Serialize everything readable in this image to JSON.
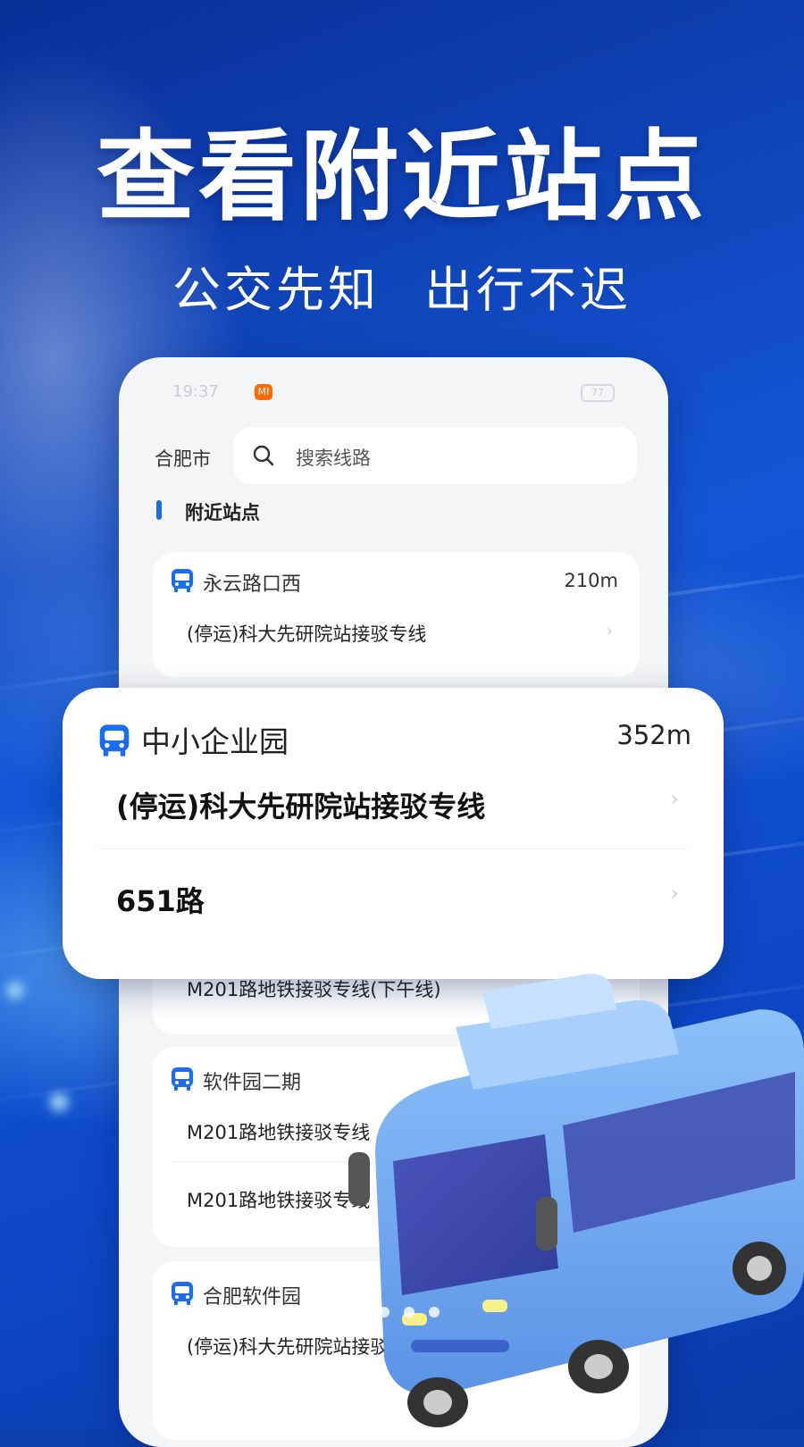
{
  "headline": "查看附近站点",
  "subline": {
    "part1": "公交先知",
    "part2": "出行不迟"
  },
  "phone": {
    "status": {
      "time": "19:37",
      "mi_badge": "MI",
      "battery": "77"
    },
    "city": "合肥市",
    "search": {
      "placeholder": "搜索线路",
      "icon": "search-icon"
    },
    "section_title": "附近站点",
    "stations": [
      {
        "name": "永云路口西",
        "distance": "210m",
        "routes": [
          "(停运)科大先研院站接驳专线"
        ]
      },
      {
        "name": "中小企业园",
        "distance": "352m",
        "routes": [
          "(停运)科大先研院站接驳专线",
          "651路",
          "M201路地铁接驳专线(下午线)"
        ]
      },
      {
        "name": "软件园二期",
        "routes": [
          "M201路地铁接驳专线",
          "M201路地铁接驳专线"
        ]
      },
      {
        "name": "合肥软件园",
        "routes": [
          "(停运)科大先研院站接驳专线"
        ]
      }
    ]
  },
  "colors": {
    "accent": "#1a6cf0",
    "background": "#0b3fae",
    "bus_body": "#6aa6f0"
  },
  "icons": {
    "station": "bus-icon",
    "chevron": "chevron-right-icon"
  }
}
